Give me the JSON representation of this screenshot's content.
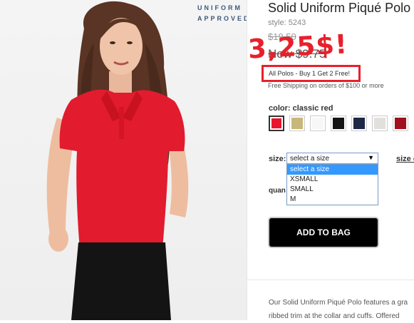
{
  "badge": {
    "line1": "UNIFORM",
    "line2": "APPROVED"
  },
  "product": {
    "title": "Solid Uniform Piqué Polo",
    "style": "style: 5243",
    "old_price": "$19.50",
    "new_price": "Now $9.75",
    "annotation_price": "3,25$!",
    "promo": "All Polos - Buy 1 Get 2 Free!",
    "shipping": "Free Shipping on orders of $100 or more"
  },
  "color": {
    "label": "color:",
    "value": "classic red",
    "swatches": [
      {
        "name": "classic red",
        "hex": "#e8142d",
        "selected": true
      },
      {
        "name": "khaki",
        "hex": "#c8b77b",
        "selected": false
      },
      {
        "name": "white",
        "hex": "#f7f7f7",
        "selected": false
      },
      {
        "name": "black",
        "hex": "#141414",
        "selected": false
      },
      {
        "name": "navy",
        "hex": "#1e2847",
        "selected": false
      },
      {
        "name": "heather grey",
        "hex": "#e2e0dc",
        "selected": false
      },
      {
        "name": "burgundy",
        "hex": "#a0101e",
        "selected": false
      }
    ]
  },
  "size": {
    "label": "size:",
    "selected": "select a size",
    "options": [
      "select a size",
      "XSMALL",
      "SMALL",
      "M"
    ],
    "chart_link": "size c"
  },
  "quantity": {
    "label": "quan"
  },
  "add_to_bag": "ADD TO BAG",
  "description": {
    "line1": "Our Solid Uniform Piqué Polo features a gra",
    "line2": "ribbed trim at the collar and cuffs. Offered"
  }
}
